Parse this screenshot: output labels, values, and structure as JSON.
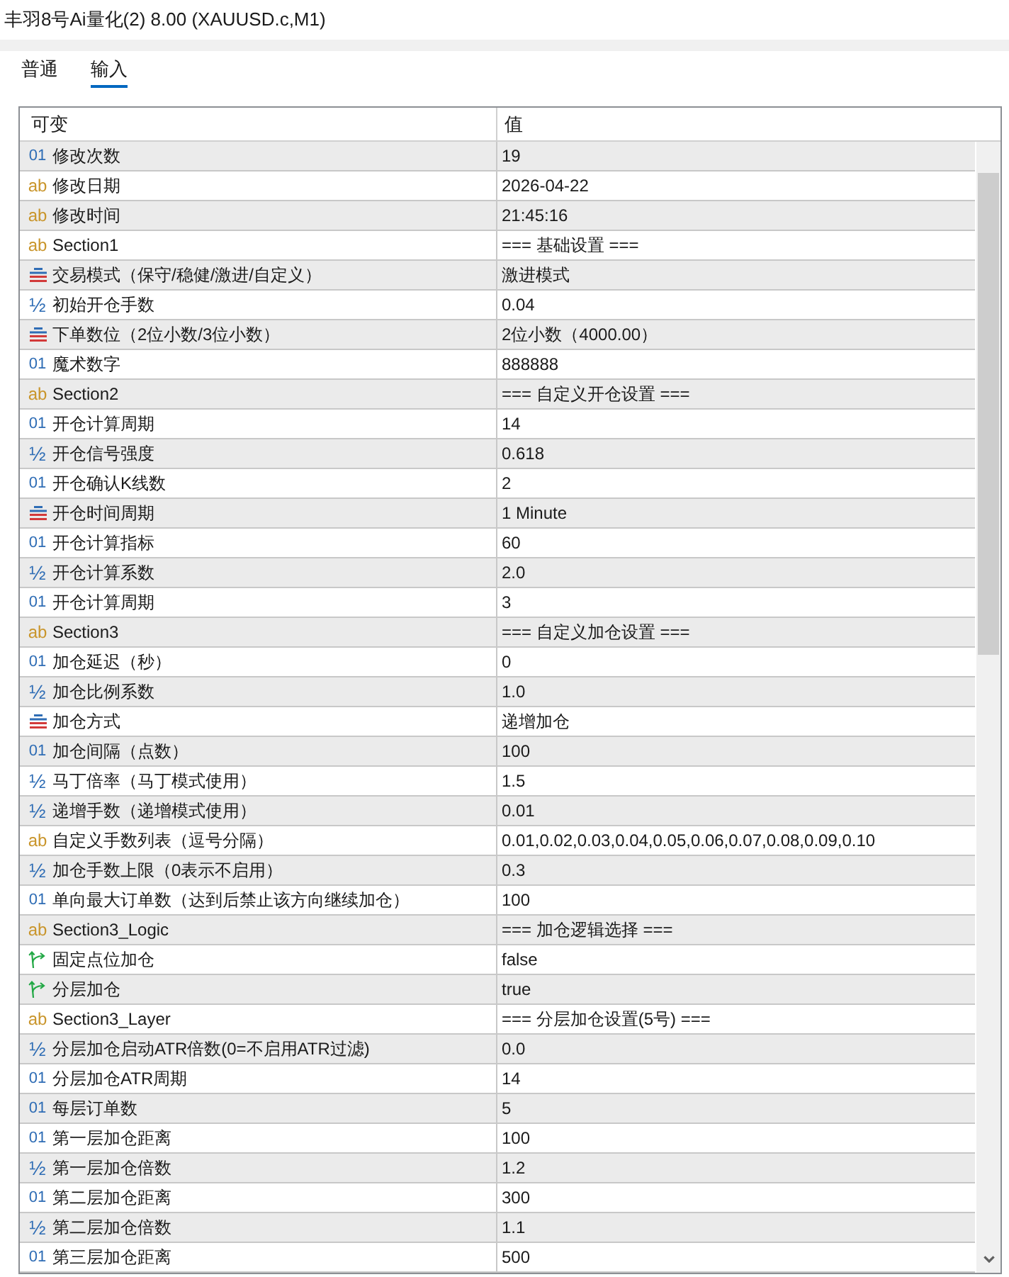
{
  "window": {
    "title": "丰羽8号Ai量化(2) 8.00 (XAUUSD.c,M1)"
  },
  "tabs": [
    {
      "label": "普通",
      "selected": false
    },
    {
      "label": "输入",
      "selected": true
    }
  ],
  "table": {
    "columns": [
      "可变",
      "值"
    ],
    "rows": [
      {
        "kind": "int",
        "type_glyph": "01",
        "name": "修改次数",
        "value": "19"
      },
      {
        "kind": "string",
        "type_glyph": "ab",
        "name": "修改日期",
        "value": "2026-04-22"
      },
      {
        "kind": "string",
        "type_glyph": "ab",
        "name": "修改时间",
        "value": "21:45:16"
      },
      {
        "kind": "string",
        "type_glyph": "ab",
        "name": "Section1",
        "value": "=== 基础设置 ==="
      },
      {
        "kind": "enum",
        "name": "交易模式（保守/稳健/激进/自定义）",
        "value": "激进模式"
      },
      {
        "kind": "double",
        "type_glyph": "½",
        "name": "初始开仓手数",
        "value": "0.04"
      },
      {
        "kind": "enum",
        "name": "下单数位（2位小数/3位小数）",
        "value": "2位小数（4000.00）"
      },
      {
        "kind": "int",
        "type_glyph": "01",
        "name": "魔术数字",
        "value": "888888"
      },
      {
        "kind": "string",
        "type_glyph": "ab",
        "name": "Section2",
        "value": "=== 自定义开仓设置 ==="
      },
      {
        "kind": "int",
        "type_glyph": "01",
        "name": "开仓计算周期",
        "value": "14"
      },
      {
        "kind": "double",
        "type_glyph": "½",
        "name": "开仓信号强度",
        "value": "0.618"
      },
      {
        "kind": "int",
        "type_glyph": "01",
        "name": "开仓确认K线数",
        "value": "2"
      },
      {
        "kind": "enum",
        "name": "开仓时间周期",
        "value": "1 Minute"
      },
      {
        "kind": "int",
        "type_glyph": "01",
        "name": "开仓计算指标",
        "value": "60"
      },
      {
        "kind": "double",
        "type_glyph": "½",
        "name": "开仓计算系数",
        "value": "2.0"
      },
      {
        "kind": "int",
        "type_glyph": "01",
        "name": "开仓计算周期",
        "value": "3"
      },
      {
        "kind": "string",
        "type_glyph": "ab",
        "name": "Section3",
        "value": "=== 自定义加仓设置 ==="
      },
      {
        "kind": "int",
        "type_glyph": "01",
        "name": "加仓延迟（秒）",
        "value": "0"
      },
      {
        "kind": "double",
        "type_glyph": "½",
        "name": "加仓比例系数",
        "value": "1.0"
      },
      {
        "kind": "enum",
        "name": "加仓方式",
        "value": "递增加仓"
      },
      {
        "kind": "int",
        "type_glyph": "01",
        "name": "加仓间隔（点数）",
        "value": "100"
      },
      {
        "kind": "double",
        "type_glyph": "½",
        "name": "马丁倍率（马丁模式使用）",
        "value": "1.5"
      },
      {
        "kind": "double",
        "type_glyph": "½",
        "name": "递增手数（递增模式使用）",
        "value": "0.01"
      },
      {
        "kind": "string",
        "type_glyph": "ab",
        "name": "自定义手数列表（逗号分隔）",
        "value": "0.01,0.02,0.03,0.04,0.05,0.06,0.07,0.08,0.09,0.10"
      },
      {
        "kind": "double",
        "type_glyph": "½",
        "name": "加仓手数上限（0表示不启用）",
        "value": "0.3"
      },
      {
        "kind": "int",
        "type_glyph": "01",
        "name": "单向最大订单数（达到后禁止该方向继续加仓）",
        "value": "100"
      },
      {
        "kind": "string",
        "type_glyph": "ab",
        "name": "Section3_Logic",
        "value": "=== 加仓逻辑选择 ==="
      },
      {
        "kind": "bool",
        "name": "固定点位加仓",
        "value": "false"
      },
      {
        "kind": "bool",
        "name": "分层加仓",
        "value": "true"
      },
      {
        "kind": "string",
        "type_glyph": "ab",
        "name": "Section3_Layer",
        "value": "=== 分层加仓设置(5号) ==="
      },
      {
        "kind": "double",
        "type_glyph": "½",
        "name": "分层加仓启动ATR倍数(0=不启用ATR过滤)",
        "value": "0.0"
      },
      {
        "kind": "int",
        "type_glyph": "01",
        "name": "分层加仓ATR周期",
        "value": "14"
      },
      {
        "kind": "int",
        "type_glyph": "01",
        "name": "每层订单数",
        "value": "5"
      },
      {
        "kind": "int",
        "type_glyph": "01",
        "name": "第一层加仓距离",
        "value": "100"
      },
      {
        "kind": "double",
        "type_glyph": "½",
        "name": "第一层加仓倍数",
        "value": "1.2"
      },
      {
        "kind": "int",
        "type_glyph": "01",
        "name": "第二层加仓距离",
        "value": "300"
      },
      {
        "kind": "double",
        "type_glyph": "½",
        "name": "第二层加仓倍数",
        "value": "1.1"
      },
      {
        "kind": "int",
        "type_glyph": "01",
        "name": "第三层加仓距离",
        "value": "500"
      }
    ]
  }
}
